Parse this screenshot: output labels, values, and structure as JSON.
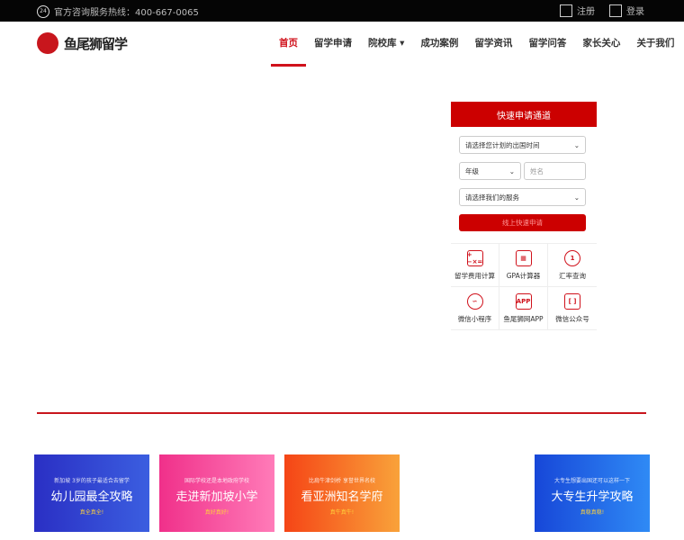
{
  "topbar": {
    "hotline": "官方咨询服务热线：400-667-0065",
    "phone_badge": "24",
    "register": "注册",
    "login": "登录"
  },
  "logo": {
    "text": "鱼尾狮留学"
  },
  "nav": [
    "首页",
    "留学申请",
    "院校库 ▾",
    "成功案例",
    "留学资讯",
    "留学问答",
    "家长关心",
    "关于我们"
  ],
  "form": {
    "title": "快速申请通道",
    "time_select": "请选择您计划的出国时间",
    "grade_select": "年级",
    "name_placeholder": "姓名",
    "service_select": "请选择我们的服务",
    "submit": "线上快速申请"
  },
  "tools": [
    {
      "label": "留学费用计算",
      "glyph": "+−×="
    },
    {
      "label": "GPA计算器",
      "glyph": "▦"
    },
    {
      "label": "汇率查询",
      "glyph": "1"
    },
    {
      "label": "微信小程序",
      "glyph": "∽"
    },
    {
      "label": "鱼尾狮网APP",
      "glyph": "APP"
    },
    {
      "label": "微信公众号",
      "glyph": "[ ]"
    }
  ],
  "banners": [
    {
      "sub": "新加坡 3岁的孩子最适合去留学",
      "title": "幼儿园最全攻略",
      "cta": "真全真全!",
      "colors": [
        "#2a2fc4",
        "#3b5ee0"
      ]
    },
    {
      "sub": "国际学校还是本地政府学校",
      "title": "走进新加坡小学",
      "cta": "真好真好!",
      "colors": [
        "#f0308a",
        "#ff7bb8"
      ]
    },
    {
      "sub": "比肩牛津剑桥 享誉世界名校",
      "title": "看亚洲知名学府",
      "cta": "真牛真牛!",
      "colors": [
        "#f54516",
        "#f9a23a"
      ]
    },
    {
      "sub": "大专生想要出国还可以这样一下",
      "title": "大专生升学攻略",
      "cta": "真稳真稳!",
      "colors": [
        "#1747d8",
        "#2f8af5"
      ]
    }
  ]
}
